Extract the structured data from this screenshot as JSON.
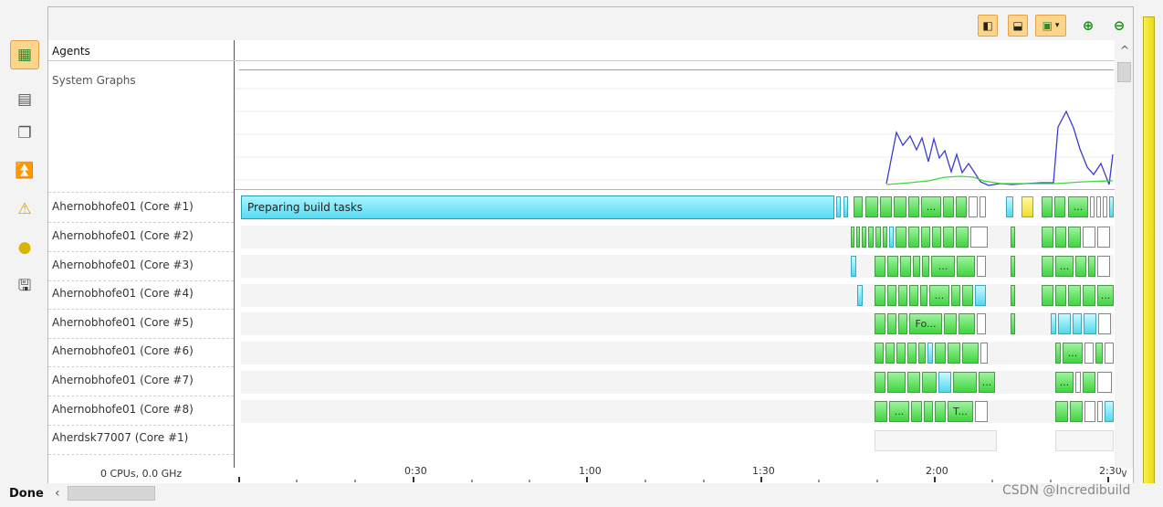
{
  "toolbar": {
    "buttons": [
      {
        "name": "agents-view-button",
        "icon": "agents-grid-icon"
      },
      {
        "name": "monitor-button",
        "icon": "monitor-icon"
      },
      {
        "name": "copy-button",
        "icon": "copy-icon"
      },
      {
        "name": "upload-button",
        "icon": "upload-icon"
      },
      {
        "name": "warning-button",
        "icon": "warning-icon"
      },
      {
        "name": "tip-button",
        "icon": "lightbulb-icon"
      },
      {
        "name": "save-button",
        "icon": "save-icon"
      }
    ],
    "view_buttons": [
      "panel-left-icon",
      "panel-bottom-icon",
      "graph-icon"
    ],
    "zoom_in_icon": "zoom-in-icon",
    "zoom_out_icon": "zoom-out-icon"
  },
  "agents_header": "Agents",
  "system_graphs_label": "System Graphs",
  "rows": [
    {
      "label": "Ahernobhofe01 (Core #1)"
    },
    {
      "label": "Ahernobhofe01 (Core #2)"
    },
    {
      "label": "Ahernobhofe01 (Core #3)"
    },
    {
      "label": "Ahernobhofe01 (Core #4)"
    },
    {
      "label": "Ahernobhofe01 (Core #5)"
    },
    {
      "label": "Ahernobhofe01 (Core #6)"
    },
    {
      "label": "Ahernobhofe01 (Core #7)"
    },
    {
      "label": "Ahernobhofe01 (Core #8)"
    },
    {
      "label": "Aherdsk77007 (Core #1)"
    }
  ],
  "prep_task_label": "Preparing build tasks",
  "task_labels": {
    "ellipsis": "...",
    "fo": "Fo...",
    "t": "T..."
  },
  "cpu_info": "0 CPUs, 0.0 GHz",
  "time_ticks": [
    "0:30",
    "1:00",
    "1:30",
    "2:00",
    "2:30"
  ],
  "status": "Done",
  "watermark": "CSDN @Incredibuild",
  "colors": {
    "task_green": "#3fd63f",
    "task_cyan": "#52d8ef",
    "cpu_line": "#3b3bd6",
    "mem_line": "#3fd63f",
    "progress_yellow": "#f0e42a",
    "active_button": "#fcd58a"
  }
}
